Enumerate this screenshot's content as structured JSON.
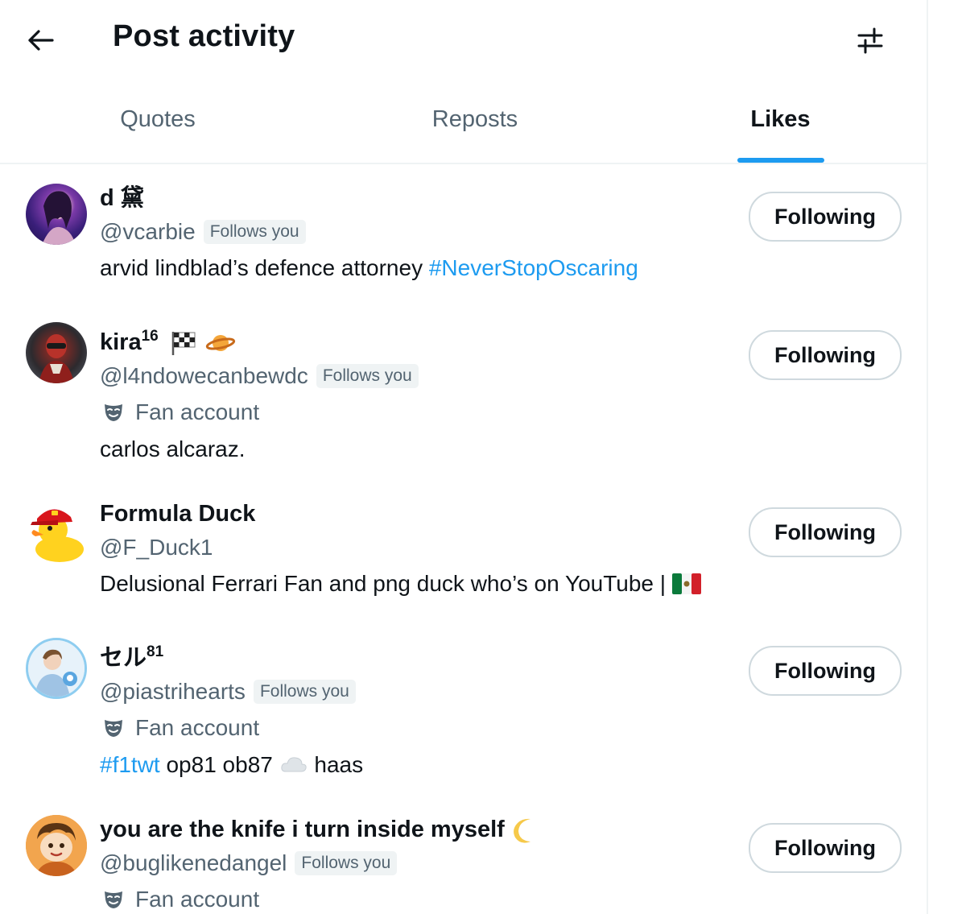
{
  "header": {
    "title": "Post activity",
    "back_icon": "arrow-left-icon",
    "settings_icon": "sliders-icon"
  },
  "tabs": [
    {
      "label": "Quotes",
      "active": false
    },
    {
      "label": "Reposts",
      "active": false
    },
    {
      "label": "Likes",
      "active": true
    }
  ],
  "colors": {
    "accent": "#1d9bf0",
    "text_primary": "#0f1419",
    "text_secondary": "#536471",
    "border": "#cfd9de"
  },
  "users": [
    {
      "name": "d",
      "name_suffix": "黛",
      "handle": "@vcarbie",
      "follows_you": "Follows you",
      "fan_account": "",
      "bio_text": "arvid lindblad’s defence attorney ",
      "bio_hashtag": "#NeverStopOscaring",
      "button": "Following"
    },
    {
      "name": "kira",
      "name_sup": "16",
      "handle": "@l4ndowecanbewdc",
      "follows_you": "Follows you",
      "fan_account": "Fan account",
      "bio_text": "carlos alcaraz.",
      "button": "Following"
    },
    {
      "name": "Formula Duck",
      "handle": "@F_Duck1",
      "follows_you": "",
      "fan_account": "",
      "bio_text": "Delusional Ferrari Fan and png duck who’s on YouTube | ",
      "button": "Following"
    },
    {
      "name": "セル",
      "name_sup": "81",
      "handle": "@piastrihearts",
      "follows_you": "Follows you",
      "fan_account": "Fan account",
      "bio_hashtag": "#f1twt",
      "bio_text": " op81 ob87 ",
      "bio_text2": " haas",
      "button": "Following"
    },
    {
      "name": "you are the knife i turn inside myself",
      "handle": "@buglikenedangel",
      "follows_you": "Follows you",
      "fan_account": "Fan account",
      "button": "Following"
    }
  ]
}
